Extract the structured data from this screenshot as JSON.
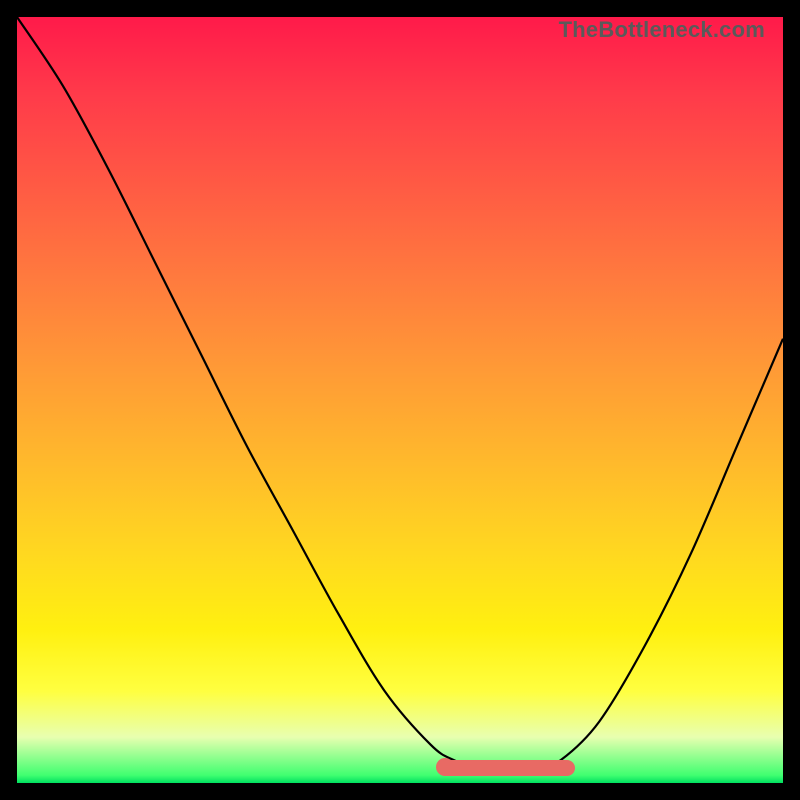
{
  "watermark": "TheBottleneck.com",
  "colors": {
    "frame": "#000000",
    "curve": "#000000",
    "marker": "#e86a64"
  },
  "chart_data": {
    "type": "line",
    "title": "",
    "xlabel": "",
    "ylabel": "",
    "xlim": [
      0,
      100
    ],
    "ylim": [
      0,
      100
    ],
    "series": [
      {
        "name": "bottleneck-curve",
        "x": [
          0,
          6,
          12,
          18,
          24,
          30,
          36,
          42,
          48,
          54,
          57,
          60,
          63,
          65,
          68,
          71,
          76,
          82,
          88,
          94,
          100
        ],
        "y": [
          100,
          91,
          80,
          68,
          56,
          44,
          33,
          22,
          12,
          5,
          3,
          2,
          2,
          2,
          2,
          3,
          8,
          18,
          30,
          44,
          58
        ]
      }
    ],
    "optimal_range": {
      "x_start": 56,
      "x_end": 72,
      "y": 2
    }
  }
}
